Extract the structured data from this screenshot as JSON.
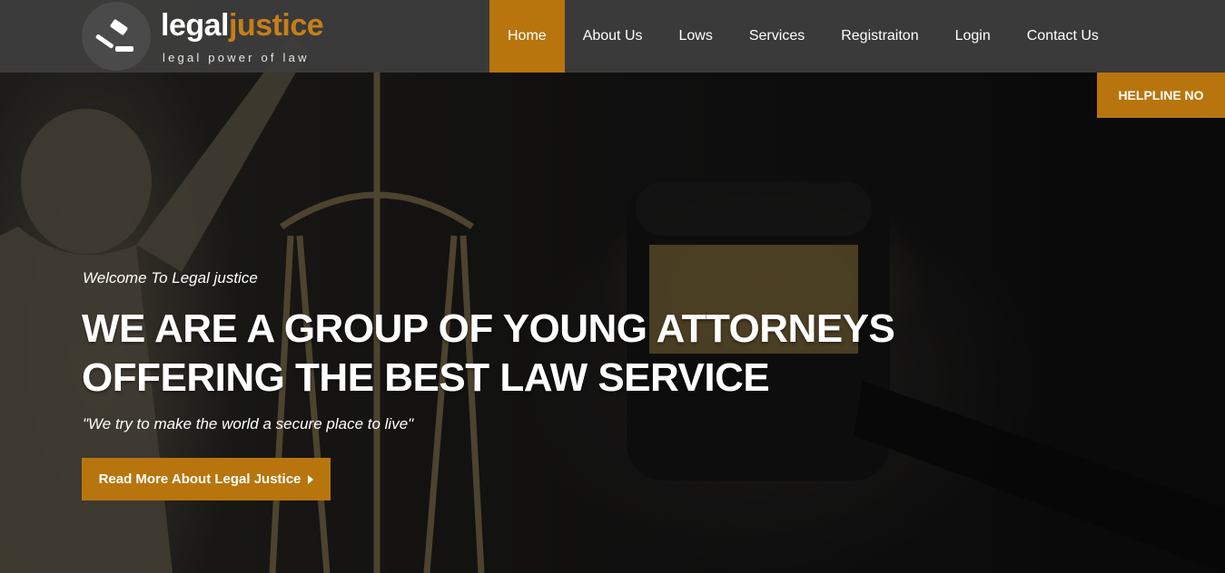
{
  "brand": {
    "name_part1": "legal",
    "name_part2": "justice",
    "tagline": "legal power of law",
    "logo_icon": "gavel-icon",
    "accent_color": "#b8750d"
  },
  "nav": {
    "items": [
      {
        "label": "Home",
        "active": true
      },
      {
        "label": "About Us",
        "active": false
      },
      {
        "label": "Lows",
        "active": false
      },
      {
        "label": "Services",
        "active": false
      },
      {
        "label": "Registraiton",
        "active": false
      },
      {
        "label": "Login",
        "active": false
      },
      {
        "label": "Contact Us",
        "active": false
      }
    ]
  },
  "helpline": {
    "label": "HELPLINE NO"
  },
  "hero": {
    "welcome": "Welcome To Legal justice",
    "headline_line1": "WE ARE A GROUP OF YOUNG ATTORNEYS",
    "headline_line2": "OFFERING THE BEST LAW SERVICE",
    "quote": "\"We try to make the world a secure place to live\"",
    "cta_label": "Read More About Legal Justice",
    "cta_icon": "caret-right-icon"
  }
}
